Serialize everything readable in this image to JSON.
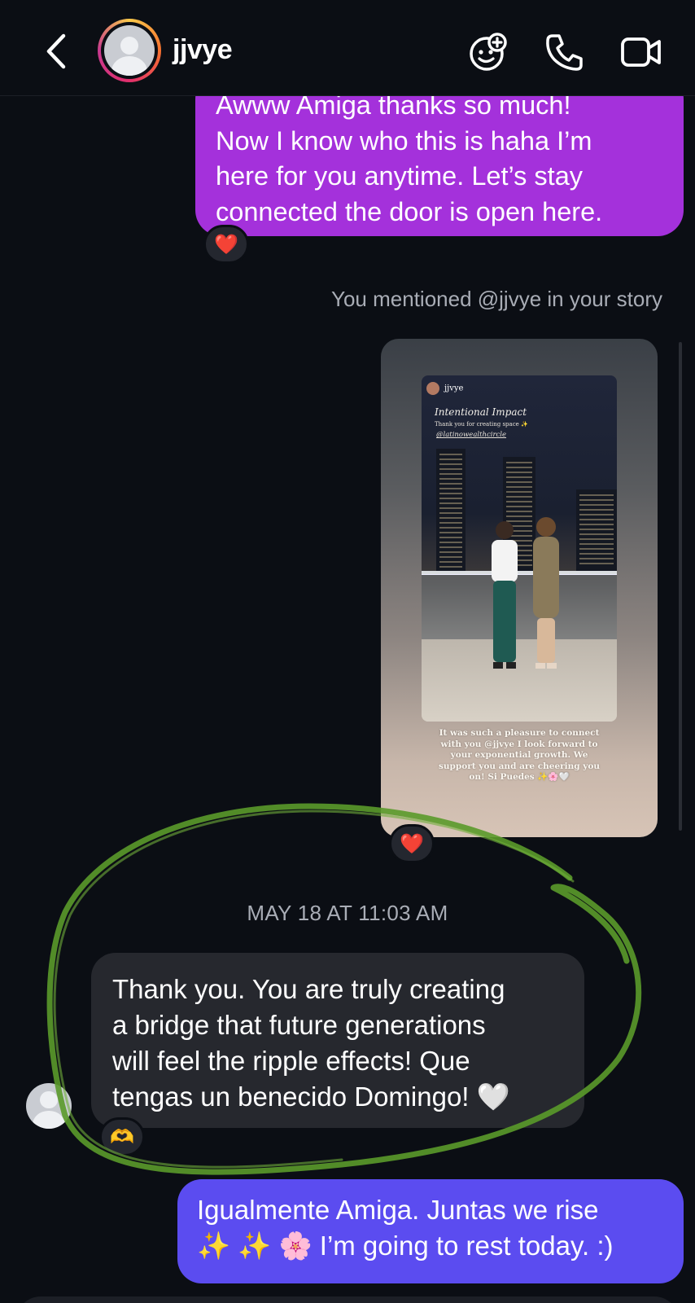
{
  "header": {
    "username": "jjvye",
    "icons": [
      "back-chevron-icon",
      "avatar",
      "sticker-icon",
      "phone-icon",
      "video-camera-icon"
    ]
  },
  "messages": {
    "outgoing_first": {
      "text": "Awww Amiga thanks so much!\nNow I know who this is haha I’m\nhere for you anytime. Let’s stay\nconnected the door is open here.",
      "reaction": "❤️"
    },
    "story_mention_note": "You mentioned @jjvye in your story",
    "story": {
      "user": "jjvye",
      "title": "Intentional Impact",
      "subtitle": "Thank you for creating space ✨",
      "tag": "@latinowealthcircle",
      "caption": "It was such a pleasure to connect with you @jjvye I look forward to your exponential growth. We support you and are cheering you on! Si Puedes ✨🌸🤍",
      "reaction": "❤️"
    },
    "timestamp": "MAY 18 AT 11:03 AM",
    "incoming": {
      "text": "Thank you. You are truly creating\na bridge that future generations\nwill feel the ripple effects! Que\ntengas un benecido Domingo! 🤍",
      "reaction": "🫶"
    },
    "outgoing_last": {
      "text": "Igualmente Amiga. Juntas we rise\n✨ ✨ 🌸 I’m going to rest today. :)"
    }
  },
  "colors": {
    "background": "#0b0e14",
    "outgoing_purple": "#a431db",
    "outgoing_blue": "#5b4cf0",
    "incoming": "#26282e",
    "scribble": "#5a9a2a"
  }
}
